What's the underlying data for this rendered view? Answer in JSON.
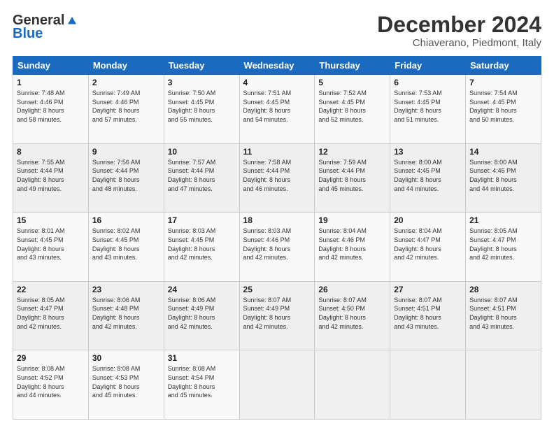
{
  "logo": {
    "general": "General",
    "blue": "Blue"
  },
  "header": {
    "month": "December 2024",
    "location": "Chiaverano, Piedmont, Italy"
  },
  "weekdays": [
    "Sunday",
    "Monday",
    "Tuesday",
    "Wednesday",
    "Thursday",
    "Friday",
    "Saturday"
  ],
  "weeks": [
    [
      {
        "day": "1",
        "sunrise": "7:48 AM",
        "sunset": "4:46 PM",
        "daylight": "8 hours and 58 minutes."
      },
      {
        "day": "2",
        "sunrise": "7:49 AM",
        "sunset": "4:46 PM",
        "daylight": "8 hours and 57 minutes."
      },
      {
        "day": "3",
        "sunrise": "7:50 AM",
        "sunset": "4:45 PM",
        "daylight": "8 hours and 55 minutes."
      },
      {
        "day": "4",
        "sunrise": "7:51 AM",
        "sunset": "4:45 PM",
        "daylight": "8 hours and 54 minutes."
      },
      {
        "day": "5",
        "sunrise": "7:52 AM",
        "sunset": "4:45 PM",
        "daylight": "8 hours and 52 minutes."
      },
      {
        "day": "6",
        "sunrise": "7:53 AM",
        "sunset": "4:45 PM",
        "daylight": "8 hours and 51 minutes."
      },
      {
        "day": "7",
        "sunrise": "7:54 AM",
        "sunset": "4:45 PM",
        "daylight": "8 hours and 50 minutes."
      }
    ],
    [
      {
        "day": "8",
        "sunrise": "7:55 AM",
        "sunset": "4:44 PM",
        "daylight": "8 hours and 49 minutes."
      },
      {
        "day": "9",
        "sunrise": "7:56 AM",
        "sunset": "4:44 PM",
        "daylight": "8 hours and 48 minutes."
      },
      {
        "day": "10",
        "sunrise": "7:57 AM",
        "sunset": "4:44 PM",
        "daylight": "8 hours and 47 minutes."
      },
      {
        "day": "11",
        "sunrise": "7:58 AM",
        "sunset": "4:44 PM",
        "daylight": "8 hours and 46 minutes."
      },
      {
        "day": "12",
        "sunrise": "7:59 AM",
        "sunset": "4:44 PM",
        "daylight": "8 hours and 45 minutes."
      },
      {
        "day": "13",
        "sunrise": "8:00 AM",
        "sunset": "4:45 PM",
        "daylight": "8 hours and 44 minutes."
      },
      {
        "day": "14",
        "sunrise": "8:00 AM",
        "sunset": "4:45 PM",
        "daylight": "8 hours and 44 minutes."
      }
    ],
    [
      {
        "day": "15",
        "sunrise": "8:01 AM",
        "sunset": "4:45 PM",
        "daylight": "8 hours and 43 minutes."
      },
      {
        "day": "16",
        "sunrise": "8:02 AM",
        "sunset": "4:45 PM",
        "daylight": "8 hours and 43 minutes."
      },
      {
        "day": "17",
        "sunrise": "8:03 AM",
        "sunset": "4:45 PM",
        "daylight": "8 hours and 42 minutes."
      },
      {
        "day": "18",
        "sunrise": "8:03 AM",
        "sunset": "4:46 PM",
        "daylight": "8 hours and 42 minutes."
      },
      {
        "day": "19",
        "sunrise": "8:04 AM",
        "sunset": "4:46 PM",
        "daylight": "8 hours and 42 minutes."
      },
      {
        "day": "20",
        "sunrise": "8:04 AM",
        "sunset": "4:47 PM",
        "daylight": "8 hours and 42 minutes."
      },
      {
        "day": "21",
        "sunrise": "8:05 AM",
        "sunset": "4:47 PM",
        "daylight": "8 hours and 42 minutes."
      }
    ],
    [
      {
        "day": "22",
        "sunrise": "8:05 AM",
        "sunset": "4:47 PM",
        "daylight": "8 hours and 42 minutes."
      },
      {
        "day": "23",
        "sunrise": "8:06 AM",
        "sunset": "4:48 PM",
        "daylight": "8 hours and 42 minutes."
      },
      {
        "day": "24",
        "sunrise": "8:06 AM",
        "sunset": "4:49 PM",
        "daylight": "8 hours and 42 minutes."
      },
      {
        "day": "25",
        "sunrise": "8:07 AM",
        "sunset": "4:49 PM",
        "daylight": "8 hours and 42 minutes."
      },
      {
        "day": "26",
        "sunrise": "8:07 AM",
        "sunset": "4:50 PM",
        "daylight": "8 hours and 42 minutes."
      },
      {
        "day": "27",
        "sunrise": "8:07 AM",
        "sunset": "4:51 PM",
        "daylight": "8 hours and 43 minutes."
      },
      {
        "day": "28",
        "sunrise": "8:07 AM",
        "sunset": "4:51 PM",
        "daylight": "8 hours and 43 minutes."
      }
    ],
    [
      {
        "day": "29",
        "sunrise": "8:08 AM",
        "sunset": "4:52 PM",
        "daylight": "8 hours and 44 minutes."
      },
      {
        "day": "30",
        "sunrise": "8:08 AM",
        "sunset": "4:53 PM",
        "daylight": "8 hours and 45 minutes."
      },
      {
        "day": "31",
        "sunrise": "8:08 AM",
        "sunset": "4:54 PM",
        "daylight": "8 hours and 45 minutes."
      },
      null,
      null,
      null,
      null
    ]
  ],
  "labels": {
    "sunrise": "Sunrise:",
    "sunset": "Sunset:",
    "daylight": "Daylight:"
  }
}
